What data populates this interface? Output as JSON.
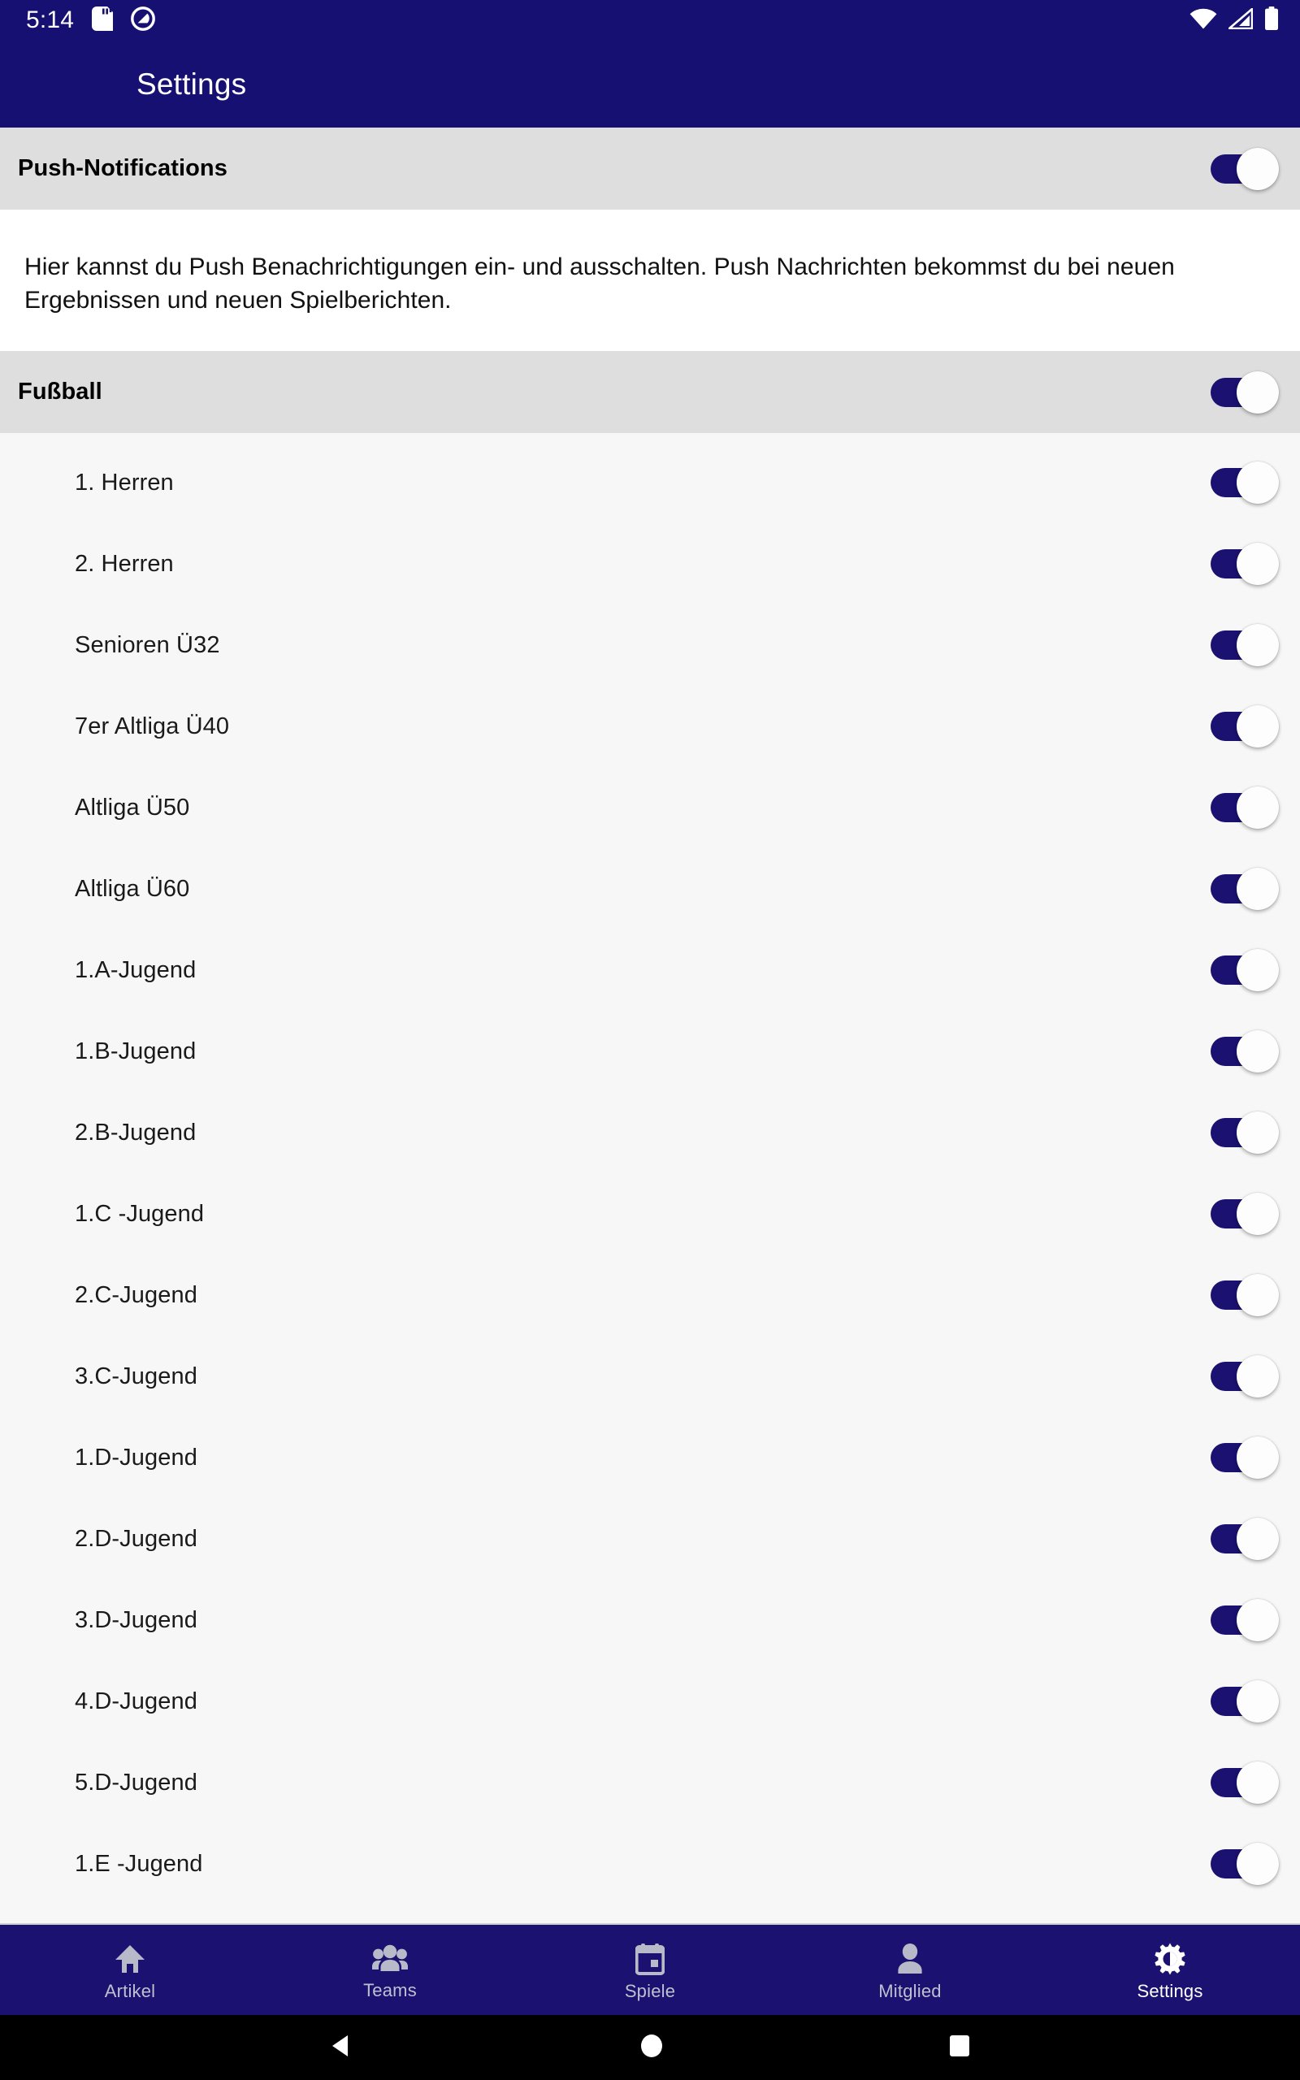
{
  "status_bar": {
    "clock": "5:14",
    "icons_left": [
      "sd-card-icon",
      "do-not-disturb-icon"
    ],
    "icons_right": [
      "wifi-icon",
      "cell-signal-icon",
      "battery-icon"
    ]
  },
  "app_bar": {
    "title": "Settings",
    "background": "#171073"
  },
  "push_section": {
    "title": "Push-Notifications",
    "toggle_on": true,
    "description": "Hier kannst du Push Benachrichtigungen ein- und ausschalten. Push Nachrichten bekommst du bei neuen Ergebnissen und neuen Spielberichten."
  },
  "football_section": {
    "title": "Fußball",
    "toggle_on": true,
    "teams": [
      {
        "label": "1. Herren",
        "toggle_on": true
      },
      {
        "label": "2. Herren",
        "toggle_on": true
      },
      {
        "label": "Senioren Ü32",
        "toggle_on": true
      },
      {
        "label": "7er Altliga Ü40",
        "toggle_on": true
      },
      {
        "label": "Altliga Ü50",
        "toggle_on": true
      },
      {
        "label": "Altliga Ü60",
        "toggle_on": true
      },
      {
        "label": "1.A-Jugend",
        "toggle_on": true
      },
      {
        "label": "1.B-Jugend",
        "toggle_on": true
      },
      {
        "label": "2.B-Jugend",
        "toggle_on": true
      },
      {
        "label": "1.C -Jugend",
        "toggle_on": true
      },
      {
        "label": "2.C-Jugend",
        "toggle_on": true
      },
      {
        "label": "3.C-Jugend",
        "toggle_on": true
      },
      {
        "label": "1.D-Jugend",
        "toggle_on": true
      },
      {
        "label": "2.D-Jugend",
        "toggle_on": true
      },
      {
        "label": "3.D-Jugend",
        "toggle_on": true
      },
      {
        "label": "4.D-Jugend",
        "toggle_on": true
      },
      {
        "label": "5.D-Jugend",
        "toggle_on": true
      },
      {
        "label": "1.E -Jugend",
        "toggle_on": true
      }
    ]
  },
  "bottom_nav": {
    "items": [
      {
        "label": "Artikel",
        "icon": "home-icon",
        "active": false
      },
      {
        "label": "Teams",
        "icon": "group-icon",
        "active": false
      },
      {
        "label": "Spiele",
        "icon": "calendar-icon",
        "active": false
      },
      {
        "label": "Mitglied",
        "icon": "person-icon",
        "active": false
      },
      {
        "label": "Settings",
        "icon": "gear-icon",
        "active": true
      }
    ]
  },
  "system_nav": {
    "back": "back-triangle-icon",
    "home": "home-circle-icon",
    "recents": "recents-square-icon"
  },
  "colors": {
    "primary": "#171073",
    "switch_on": "#1a1170",
    "section_header_bg": "#dedede",
    "list_bg": "#f7f7f7"
  }
}
